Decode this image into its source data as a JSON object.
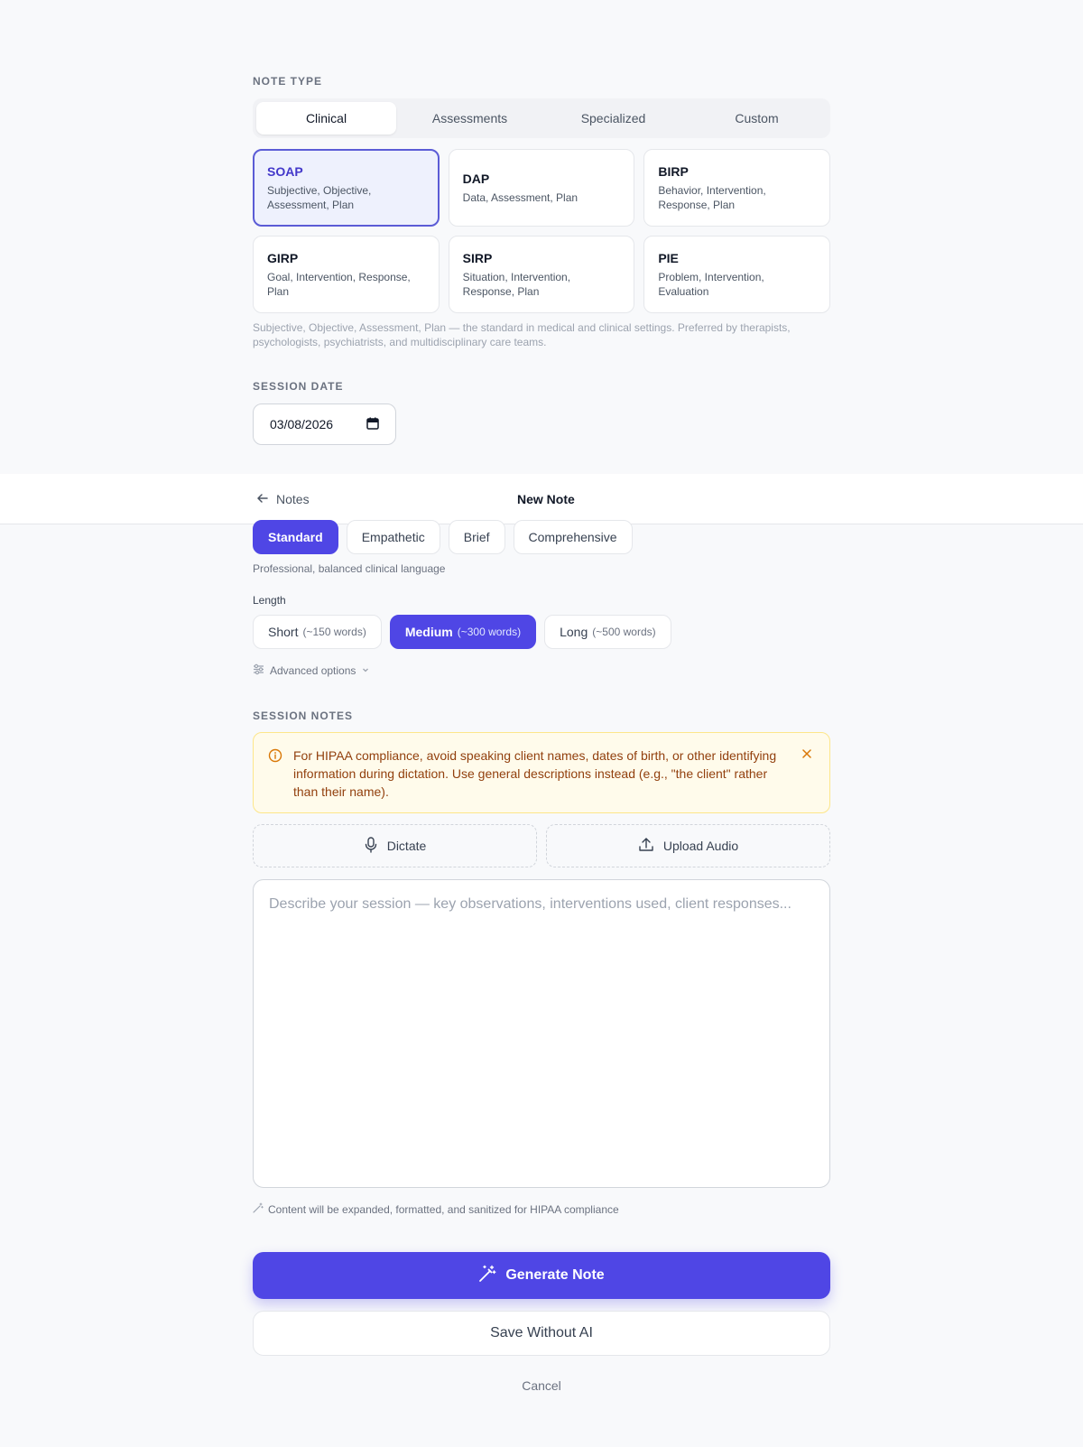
{
  "note_type": {
    "label": "NOTE TYPE",
    "tabs": [
      "Clinical",
      "Assessments",
      "Specialized",
      "Custom"
    ],
    "active_tab": "Clinical",
    "cards": [
      {
        "name": "SOAP",
        "desc": "Subjective, Objective, Assessment, Plan"
      },
      {
        "name": "DAP",
        "desc": "Data, Assessment, Plan"
      },
      {
        "name": "BIRP",
        "desc": "Behavior, Intervention, Response, Plan"
      },
      {
        "name": "GIRP",
        "desc": "Goal, Intervention, Response, Plan"
      },
      {
        "name": "SIRP",
        "desc": "Situation, Intervention, Response, Plan"
      },
      {
        "name": "PIE",
        "desc": "Problem, Intervention, Evaluation"
      }
    ],
    "selected": "SOAP",
    "help": "Subjective, Objective, Assessment, Plan — the standard in medical and clinical settings. Preferred by therapists, psychologists, psychiatrists, and multidisciplinary care teams."
  },
  "session_date": {
    "label": "SESSION DATE",
    "value": "03/08/2026"
  },
  "header": {
    "back_label": "Notes",
    "title": "New Note"
  },
  "tone": {
    "options": [
      "Standard",
      "Empathetic",
      "Brief",
      "Comprehensive"
    ],
    "selected": "Standard",
    "description": "Professional, balanced clinical language"
  },
  "length": {
    "label": "Length",
    "options": [
      {
        "label": "Short",
        "sub": "(~150 words)"
      },
      {
        "label": "Medium",
        "sub": "(~300 words)"
      },
      {
        "label": "Long",
        "sub": "(~500 words)"
      }
    ],
    "selected": "Medium"
  },
  "advanced_label": "Advanced options",
  "session_notes": {
    "label": "SESSION NOTES",
    "alert": "For HIPAA compliance, avoid speaking client names, dates of birth, or other identifying information during dictation. Use general descriptions instead (e.g., \"the client\" rather than their name).",
    "dictate_label": "Dictate",
    "upload_label": "Upload Audio",
    "placeholder": "Describe your session — key observations, interventions used, client responses...",
    "hint": "Content will be expanded, formatted, and sanitized for HIPAA compliance"
  },
  "actions": {
    "generate": "Generate Note",
    "save": "Save Without AI",
    "cancel": "Cancel"
  },
  "colors": {
    "accent": "#4f46e5",
    "alert_bg": "#fffbeb",
    "alert_text": "#92400e"
  }
}
